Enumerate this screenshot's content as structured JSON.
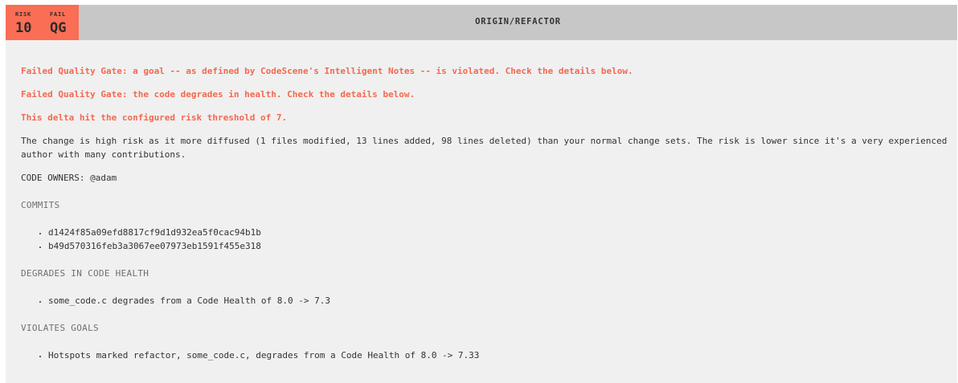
{
  "header": {
    "risk_label": "RISK",
    "risk_value": "10",
    "fail_label": "FAIL",
    "fail_value": "QG",
    "title": "ORIGIN/REFACTOR",
    "badge_color": "#fa6e55",
    "bar_color": "#c7c7c7"
  },
  "warnings": [
    "Failed Quality Gate: a goal -- as defined by CodeScene's Intelligent Notes -- is violated. Check the details below.",
    "Failed Quality Gate: the code degrades in health. Check the details below.",
    "This delta hit the configured risk threshold of 7."
  ],
  "warning_color": "#f4684f",
  "description": "The change is high risk as it more diffused (1 files modified, 13 lines added, 98 lines deleted) than your normal change sets. The risk is lower since it's a very experienced author with many contributions.",
  "code_owners": "CODE OWNERS: @adam",
  "commits": {
    "title": "COMMITS",
    "items": [
      "d1424f85a09efd8817cf9d1d932ea5f0cac94b1b",
      "b49d570316feb3a3067ee07973eb1591f455e318"
    ]
  },
  "degrades": {
    "title": "DEGRADES IN CODE HEALTH",
    "items": [
      "some_code.c degrades from a Code Health of 8.0 -> 7.3"
    ]
  },
  "violates": {
    "title": "VIOLATES GOALS",
    "items": [
      "Hotspots marked refactor, some_code.c, degrades from a Code Health of 8.0 -> 7.33"
    ]
  }
}
